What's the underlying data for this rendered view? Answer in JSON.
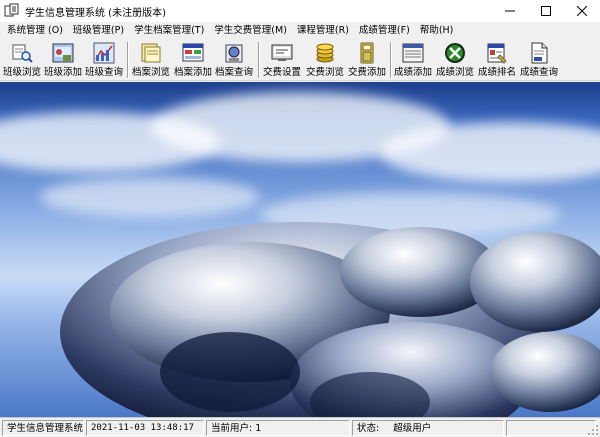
{
  "window": {
    "title": "学生信息管理系统 (未注册版本)",
    "controls": [
      "minimize-icon",
      "maximize-icon",
      "close-icon"
    ]
  },
  "menu": [
    "系统管理 (O)",
    "班级管理(P)",
    "学生档案管理(T)",
    "学生交费管理(M)",
    "课程管理(R)",
    "成绩管理(F)",
    "帮助(H)"
  ],
  "toolbar": {
    "buttons": [
      {
        "label": "班级浏览",
        "icon": "class-browse-icon"
      },
      {
        "label": "班级添加",
        "icon": "class-add-icon"
      },
      {
        "label": "班级查询",
        "icon": "class-query-icon"
      },
      {
        "label": "档案浏览",
        "icon": "archive-browse-icon"
      },
      {
        "label": "档案添加",
        "icon": "archive-add-icon"
      },
      {
        "label": "档案查询",
        "icon": "archive-query-icon"
      },
      {
        "label": "交费设置",
        "icon": "fee-settings-icon"
      },
      {
        "label": "交费浏览",
        "icon": "fee-browse-icon"
      },
      {
        "label": "交费添加",
        "icon": "fee-add-icon"
      },
      {
        "label": "成绩添加",
        "icon": "grade-add-icon"
      },
      {
        "label": "成绩浏览",
        "icon": "grade-browse-icon"
      },
      {
        "label": "成绩排名",
        "icon": "grade-rank-icon"
      },
      {
        "label": "成绩查询",
        "icon": "grade-query-icon"
      }
    ]
  },
  "status": {
    "app_name": "学生信息管理系统",
    "datetime": "2021-11-03 13:48:17",
    "current_user": "当前用户: 1",
    "state_label": "状态:",
    "state_value": "超级用户"
  }
}
